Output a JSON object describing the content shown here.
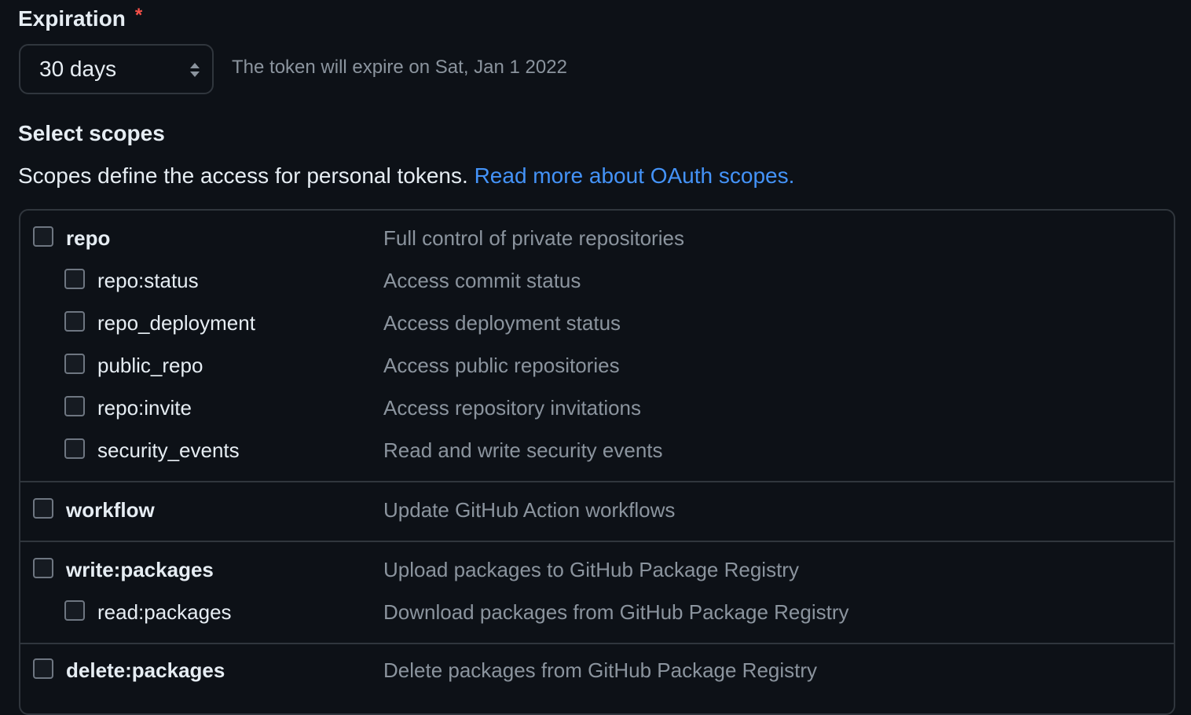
{
  "expiration": {
    "label": "Expiration",
    "required_mark": "*",
    "selected": "30 days",
    "note": "The token will expire on Sat, Jan 1 2022"
  },
  "scopes": {
    "title": "Select scopes",
    "description": "Scopes define the access for personal tokens.",
    "link_text": "Read more about OAuth scopes.",
    "items": [
      {
        "name": "repo",
        "desc": "Full control of private repositories",
        "checked": false
      },
      {
        "name": "repo:status",
        "desc": "Access commit status",
        "checked": false
      },
      {
        "name": "repo_deployment",
        "desc": "Access deployment status",
        "checked": false
      },
      {
        "name": "public_repo",
        "desc": "Access public repositories",
        "checked": false
      },
      {
        "name": "repo:invite",
        "desc": "Access repository invitations",
        "checked": false
      },
      {
        "name": "security_events",
        "desc": "Read and write security events",
        "checked": false
      },
      {
        "name": "workflow",
        "desc": "Update GitHub Action workflows",
        "checked": false
      },
      {
        "name": "write:packages",
        "desc": "Upload packages to GitHub Package Registry",
        "checked": false
      },
      {
        "name": "read:packages",
        "desc": "Download packages from GitHub Package Registry",
        "checked": false
      },
      {
        "name": "delete:packages",
        "desc": "Delete packages from GitHub Package Registry",
        "checked": false
      }
    ]
  },
  "colors": {
    "background": "#0d1117",
    "text": "#e6edf3",
    "muted": "#8b949e",
    "link": "#4493f8",
    "border": "#30363d",
    "required": "#f85149"
  },
  "icons": {
    "select_arrows": "chevron-up-down-icon"
  }
}
